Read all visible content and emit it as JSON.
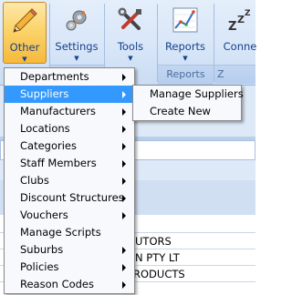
{
  "ribbon": {
    "buttons": [
      {
        "label": "Other",
        "icon": "pencil-icon"
      },
      {
        "label": "Settings",
        "icon": "gears-icon"
      },
      {
        "label": "Tools",
        "icon": "tools-icon"
      },
      {
        "label": "Reports",
        "icon": "chart-icon"
      },
      {
        "label": "Conne",
        "icon": "sleep-icon"
      }
    ],
    "groups": [
      {
        "label": "ls"
      },
      {
        "label": "Reports"
      },
      {
        "label": "Z Conne"
      }
    ]
  },
  "background": {
    "rows": [
      "UTORS",
      "N PTY LT",
      "RODUCTS"
    ]
  },
  "menu": {
    "items": [
      {
        "label": "Departments",
        "submenu": true
      },
      {
        "label": "Suppliers",
        "submenu": true,
        "selected": true
      },
      {
        "label": "Manufacturers",
        "submenu": true
      },
      {
        "label": "Locations",
        "submenu": true
      },
      {
        "label": "Categories",
        "submenu": true
      },
      {
        "label": "Staff Members",
        "submenu": true
      },
      {
        "label": "Clubs",
        "submenu": true
      },
      {
        "label": "Discount Structures",
        "submenu": true
      },
      {
        "label": "Vouchers",
        "submenu": true
      },
      {
        "label": "Manage Scripts",
        "submenu": false
      },
      {
        "label": "Suburbs",
        "submenu": true
      },
      {
        "label": "Policies",
        "submenu": true
      },
      {
        "label": "Reason Codes",
        "submenu": true
      }
    ]
  },
  "submenu": {
    "items": [
      {
        "label": "Manage Suppliers"
      },
      {
        "label": "Create New"
      }
    ]
  },
  "colors": {
    "selection": "#3399ff",
    "ribbon_text": "#15428b",
    "active_button": "#fbd46c"
  }
}
